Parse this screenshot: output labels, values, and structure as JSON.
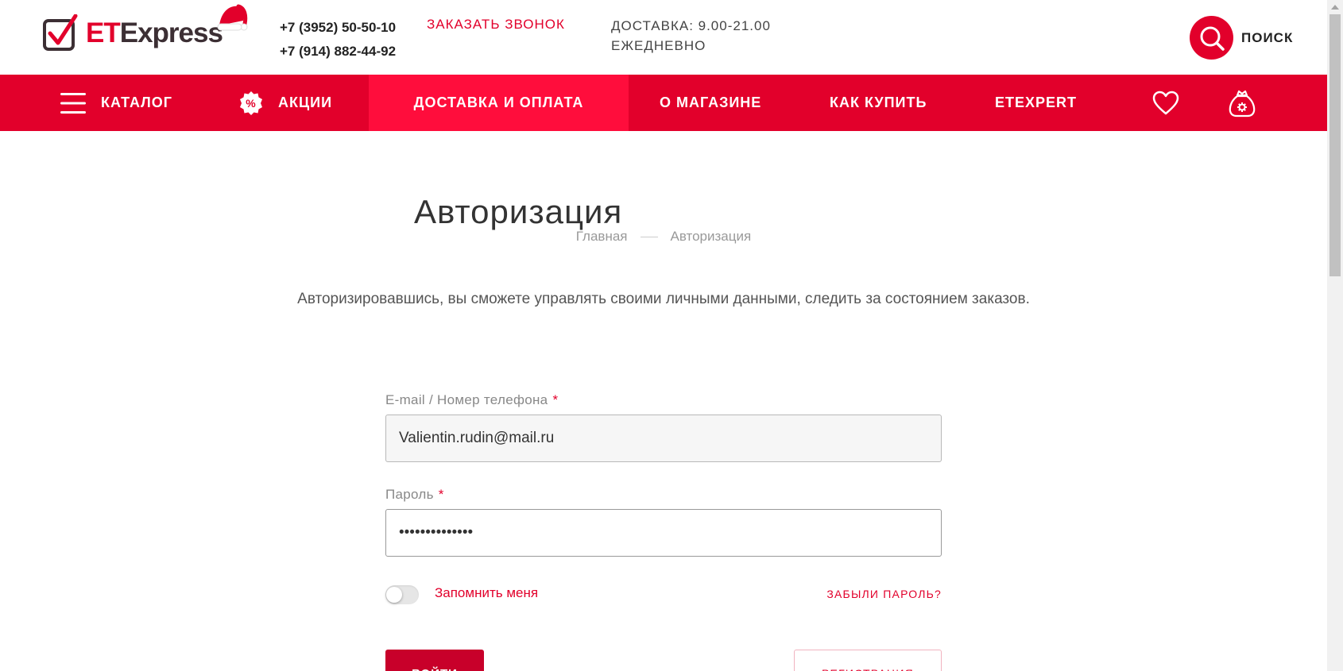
{
  "header": {
    "logo": {
      "part1": "ET",
      "part2": "Express"
    },
    "phones": [
      "+7 (3952) 50-50-10",
      "+7 (914) 882-44-92"
    ],
    "callback": "ЗАКАЗАТЬ ЗВОНОК",
    "delivery": [
      "ДОСТАВКА: 9.00-21.00",
      "ЕЖЕДНЕВНО"
    ],
    "search_label": "ПОИСК",
    "search_icon": "search-icon"
  },
  "nav": {
    "items": [
      {
        "label": "КАТАЛОГ",
        "icon": "menu-icon"
      },
      {
        "label": "АКЦИИ",
        "icon": "percent-badge-icon"
      },
      {
        "label": "ДОСТАВКА И ОПЛАТА",
        "active": true
      },
      {
        "label": "О МАГАЗИНЕ"
      },
      {
        "label": "КАК КУПИТЬ"
      },
      {
        "label": "ETEXPERT"
      }
    ],
    "favorites_icon": "heart-icon",
    "cart_icon": "bag-icon",
    "accent_color": "#e2002b",
    "active_color": "#ff0d3c"
  },
  "page": {
    "title": "Авторизация",
    "breadcrumb": [
      "Главная",
      "Авторизация"
    ],
    "intro": "Авторизировавшись, вы сможете управлять своими личными данными, следить за состоянием заказов."
  },
  "form": {
    "login_label": "E-mail / Номер телефона",
    "required_mark": "*",
    "login_value": "Valientin.rudin@mail.ru",
    "password_label": "Пароль",
    "password_value": "••••••••••••••",
    "remember_label": "Запомнить меня",
    "remember_checked": false,
    "forgot": "ЗАБЫЛИ ПАРОЛЬ?",
    "login_button": "ВОЙТИ",
    "register_button": "РЕГИСТРАЦИЯ"
  }
}
